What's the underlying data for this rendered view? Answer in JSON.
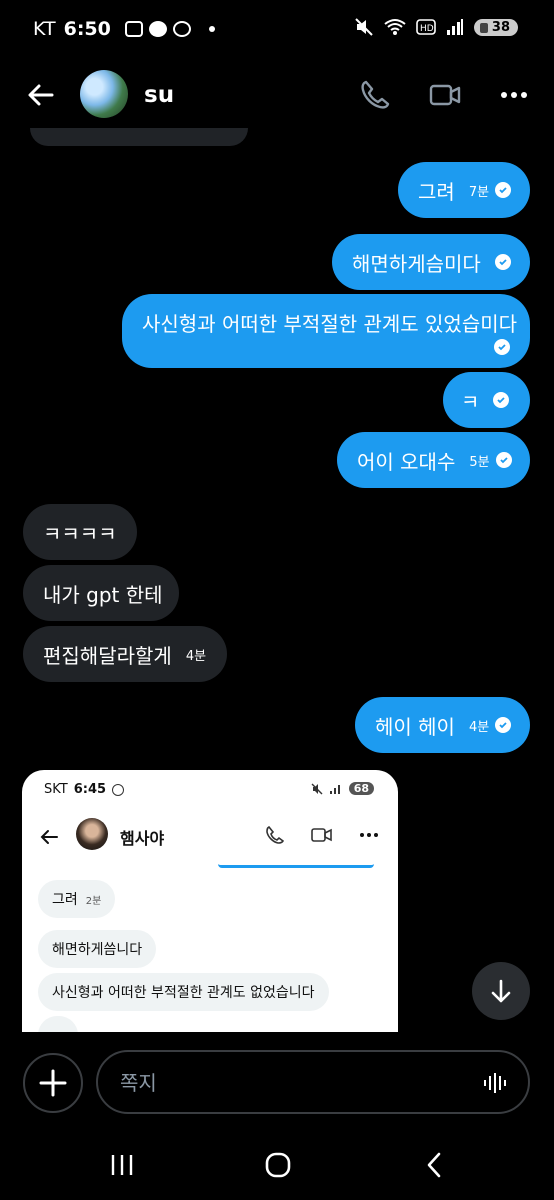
{
  "status_bar": {
    "carrier": "KT",
    "time": "6:50",
    "battery": "38"
  },
  "header": {
    "contact_name": "su"
  },
  "messages": [
    {
      "text": "그려",
      "time": "7분",
      "from": "me"
    },
    {
      "text": "해면하게슴미다",
      "time": "",
      "from": "me"
    },
    {
      "text": "사신형과 어떠한 부적절한 관계도 있었습미다",
      "time": "",
      "from": "me"
    },
    {
      "text": "ㅋ",
      "time": "",
      "from": "me"
    },
    {
      "text": "어이 오대수",
      "time": "5분",
      "from": "me"
    },
    {
      "text": "ㅋㅋㅋㅋ",
      "time": "",
      "from": "them"
    },
    {
      "text": "내가 gpt 한테",
      "time": "",
      "from": "them"
    },
    {
      "text": "편집해달라할게",
      "time": "4분",
      "from": "them"
    },
    {
      "text": "헤이 헤이",
      "time": "4분",
      "from": "me"
    }
  ],
  "attachment": {
    "status_carrier": "SKT",
    "status_time": "6:45",
    "status_battery": "68",
    "contact_name": "햄사야",
    "messages": [
      {
        "text": "그려",
        "time": "2분"
      },
      {
        "text": "해면하게씀니다",
        "time": ""
      },
      {
        "text": "사신형과 어떠한 부적절한 관계도 없었습니다",
        "time": ""
      }
    ]
  },
  "composer": {
    "placeholder": "쪽지"
  },
  "colors": {
    "sent_bubble": "#1d9bf0",
    "received_bubble": "#202327",
    "background": "#000000"
  }
}
